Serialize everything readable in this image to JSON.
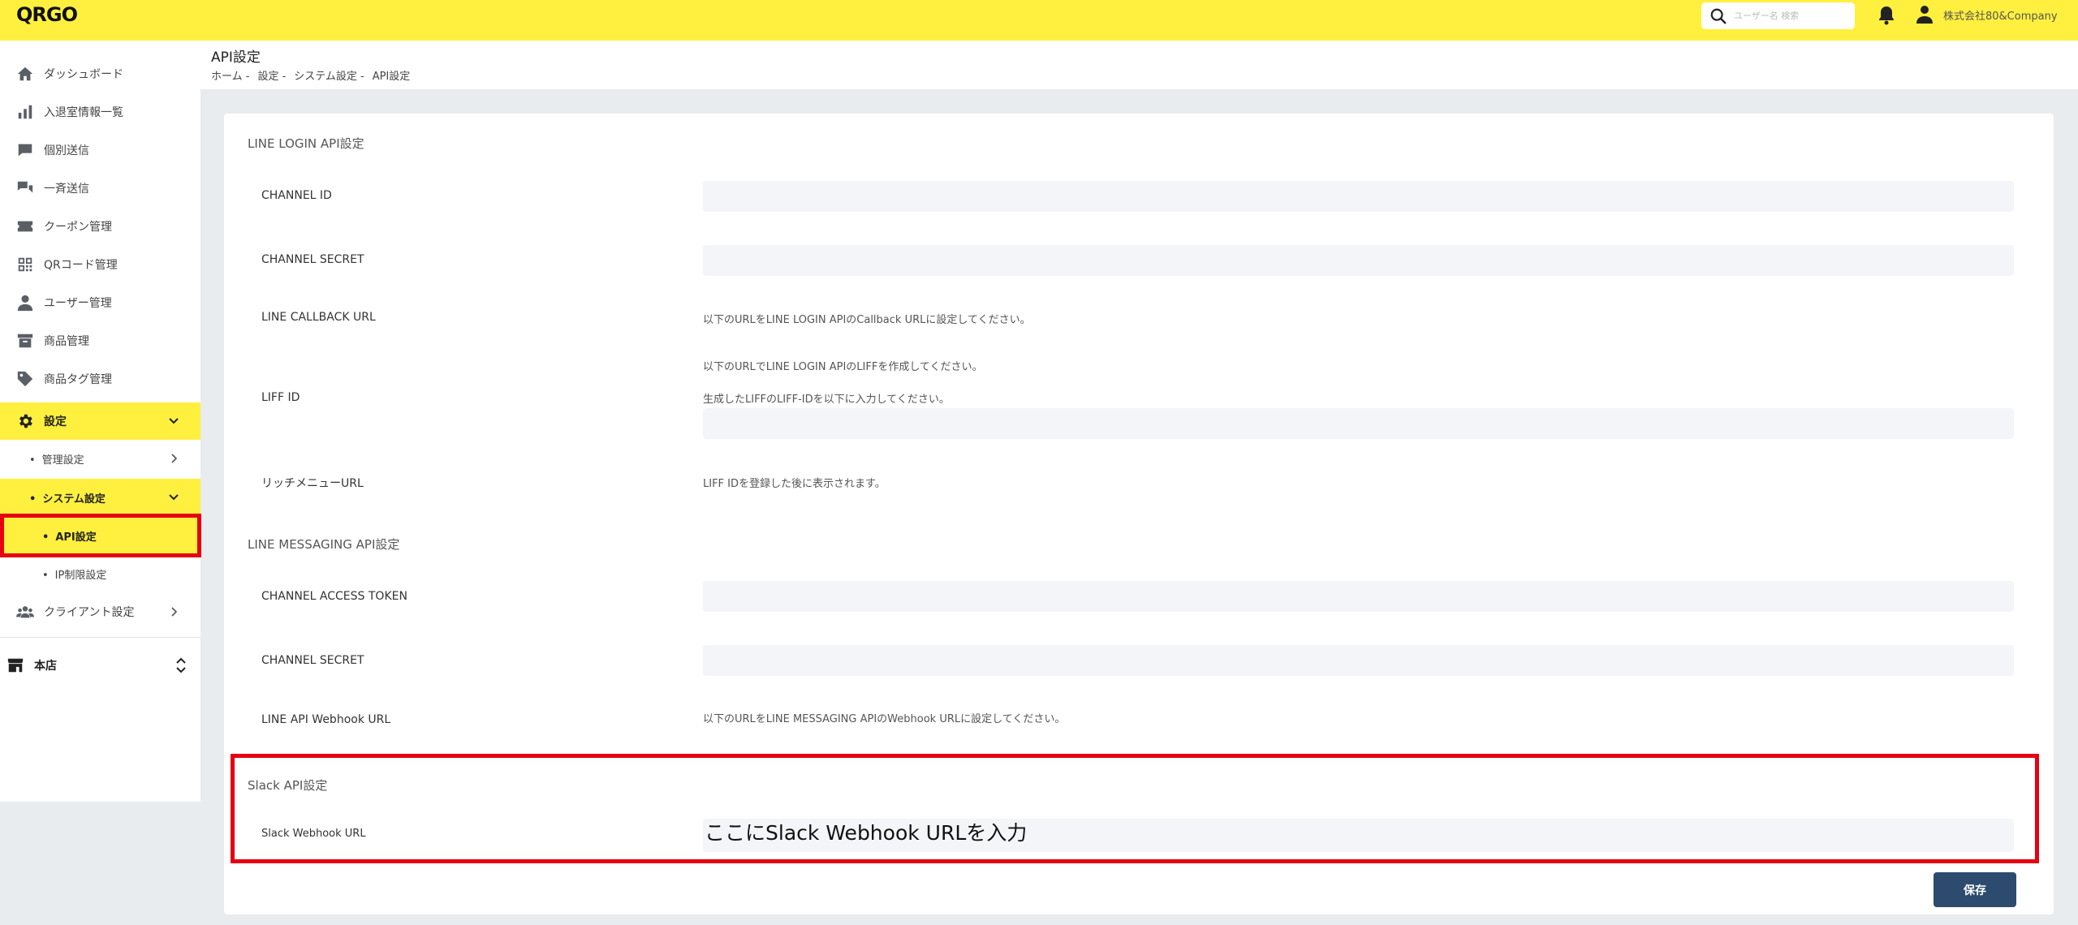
{
  "topbar": {
    "logo": "QRGO",
    "search_placeholder": "ユーザー名 検索",
    "company": "株式会社80&Company"
  },
  "sidebar": {
    "items": [
      {
        "label": "ダッシュボード",
        "icon": "home-icon"
      },
      {
        "label": "入退室情報一覧",
        "icon": "bar-chart-icon"
      },
      {
        "label": "個別送信",
        "icon": "chat-icon"
      },
      {
        "label": "一斉送信",
        "icon": "chat-multi-icon"
      },
      {
        "label": "クーポン管理",
        "icon": "coupon-icon"
      },
      {
        "label": "QRコード管理",
        "icon": "qr-code-icon"
      },
      {
        "label": "ユーザー管理",
        "icon": "user-icon"
      },
      {
        "label": "商品管理",
        "icon": "archive-icon"
      },
      {
        "label": "商品タグ管理",
        "icon": "tag-icon"
      },
      {
        "label": "設定",
        "icon": "gear-icon"
      }
    ],
    "settings_sub": [
      {
        "label": "管理設定"
      },
      {
        "label": "システム設定"
      }
    ],
    "system_sub": [
      {
        "label": "API設定"
      },
      {
        "label": "IP制限設定"
      }
    ],
    "client_settings": "クライアント設定",
    "store": "本店"
  },
  "header": {
    "title": "API設定",
    "breadcrumb": [
      "ホーム -",
      "設定 -",
      "システム設定 -",
      "API設定"
    ]
  },
  "line_login": {
    "title": "LINE LOGIN API設定",
    "channel_id_label": "CHANNEL ID",
    "channel_secret_label": "CHANNEL SECRET",
    "callback_label": "LINE CALLBACK URL",
    "callback_hint": "以下のURLをLINE LOGIN APIのCallback URLに設定してください。",
    "liff_label": "LIFF ID",
    "liff_hint1": "以下のURLでLINE LOGIN APIのLIFFを作成してください。",
    "liff_hint2": "生成したLIFFのLIFF-IDを以下に入力してください。",
    "richmenu_label": "リッチメニューURL",
    "richmenu_hint": "LIFF IDを登録した後に表示されます。"
  },
  "line_messaging": {
    "title": "LINE MESSAGING API設定",
    "access_token_label": "CHANNEL ACCESS TOKEN",
    "channel_secret_label": "CHANNEL SECRET",
    "webhook_label": "LINE API Webhook URL",
    "webhook_hint": "以下のURLをLINE MESSAGING APIのWebhook URLに設定してください。"
  },
  "slack": {
    "title": "Slack API設定",
    "webhook_label": "Slack Webhook URL",
    "webhook_value": "ここにSlack Webhook URLを入力"
  },
  "save_label": "保存",
  "colors": {
    "accent": "#fff03f",
    "primary": "#2c4b6e",
    "highlight": "#e50012"
  }
}
